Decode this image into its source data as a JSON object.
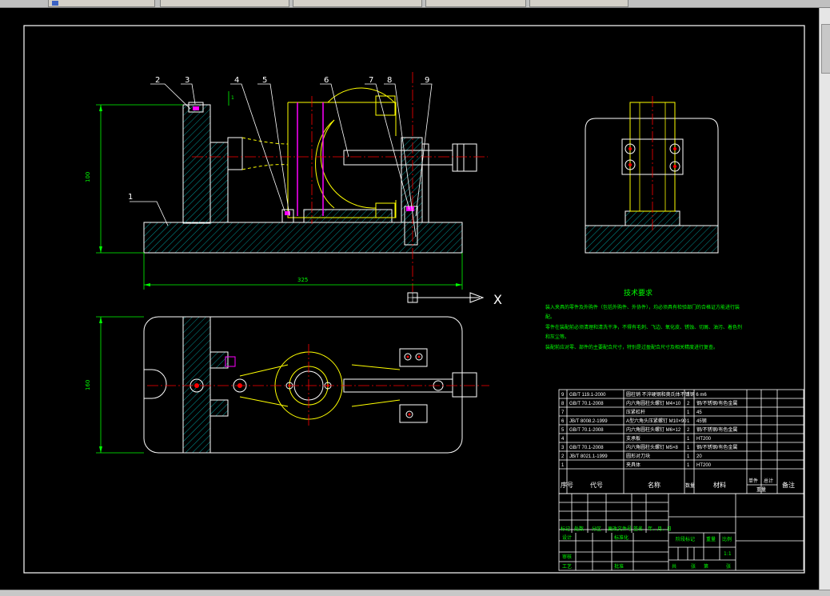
{
  "tabs": [
    {
      "label": ""
    },
    {
      "label": ""
    },
    {
      "label": ""
    },
    {
      "label": ""
    },
    {
      "label": ""
    }
  ],
  "dims": {
    "height_front": "100",
    "length_front": "325",
    "height_top": "160",
    "small_dim": "1"
  },
  "balloons": [
    "1",
    "2",
    "3",
    "4",
    "5",
    "6",
    "7",
    "8",
    "9"
  ],
  "axis_label": "X",
  "tech": {
    "title": "技术要求",
    "lines": [
      "装入夹具的零件及外购件（包括外购件、外协件），均必须具有检验部门的合格证方能进行装",
      "配。",
      "零件在装配前必须清理和清洗干净，不得有毛刺、飞边、氧化皮、锈蚀、切屑、油污、着色剂",
      "和灰尘等。",
      "装配前应对零、部件的主要配合尺寸，特别是过盈配合尺寸及相关精度进行复查。"
    ]
  },
  "bom": {
    "rows": [
      {
        "no": "9",
        "code": "GB/T 119.1-2000",
        "name": "圆柱销 不淬硬钢和奥氏体不锈钢 6 m6",
        "qty": "2",
        "material": ""
      },
      {
        "no": "8",
        "code": "GB/T 70.1-2008",
        "name": "内六角圆柱头螺钉 M4×10",
        "qty": "2",
        "material": "钢/不锈钢/有色金属"
      },
      {
        "no": "7",
        "code": "",
        "name": "压紧杠杆",
        "qty": "1",
        "material": "45"
      },
      {
        "no": "6",
        "code": "JB/T 8008.2-1999",
        "name": "A型六角头压紧螺钉 M10×90",
        "qty": "1",
        "material": "45钢"
      },
      {
        "no": "5",
        "code": "GB/T 70.1-2008",
        "name": "内六角圆柱头螺钉 M6×12",
        "qty": "2",
        "material": "钢/不锈钢/有色金属"
      },
      {
        "no": "4",
        "code": "",
        "name": "支承板",
        "qty": "1",
        "material": "HT200"
      },
      {
        "no": "3",
        "code": "GB/T 70.1-2008",
        "name": "内六角圆柱头螺钉 M5×8",
        "qty": "1",
        "material": "钢/不锈钢/有色金属"
      },
      {
        "no": "2",
        "code": "JB/T 8021.1-1999",
        "name": "圆形对刀块",
        "qty": "1",
        "material": "20"
      },
      {
        "no": "1",
        "code": "",
        "name": "夹具体",
        "qty": "1",
        "material": "HT200"
      }
    ],
    "header": {
      "no": "序号",
      "code": "代号",
      "name": "名称",
      "qty": "数量",
      "material": "材料",
      "single": "单件",
      "total": "总计",
      "weight": "重量",
      "remark": "备注"
    }
  },
  "title_block": {
    "marks": "标记",
    "count": "处数",
    "zone": "分区",
    "change_doc": "更改文件号",
    "sign": "签名",
    "date": "年、月、日",
    "design": "设计",
    "standard": "标准化",
    "review": "审核",
    "process": "工艺",
    "approve": "批准",
    "stage": "阶段标记",
    "weight": "重量",
    "scale": "比例",
    "scale_value": "1:1",
    "sheets_total": "共",
    "sheets_total_unit": "张",
    "sheet_no": "第",
    "sheet_no_unit": "张"
  },
  "colors": {
    "outline": "#ffffff",
    "hatch": "#00c0c0",
    "yellow": "#ffff00",
    "magenta": "#ff00ff",
    "red": "#ff0000",
    "green": "#00ff00",
    "frame": "#ffffff"
  }
}
